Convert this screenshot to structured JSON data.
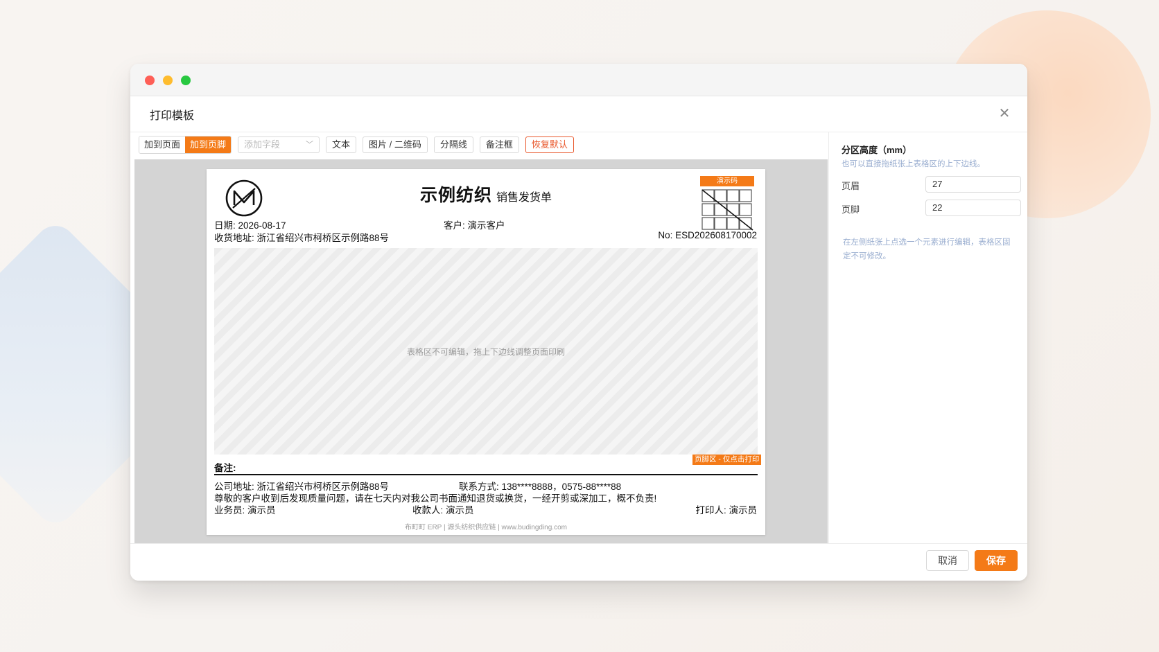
{
  "dialog": {
    "title": "打印模板"
  },
  "toolbar": {
    "add_to_page": "加到页面",
    "add_to_footer": "加到页脚",
    "add_field_placeholder": "添加字段",
    "text": "文本",
    "image_qr": "图片 / 二维码",
    "divider": "分隔线",
    "note_box": "备注框",
    "restore_default": "恢复默认"
  },
  "paper": {
    "company_name": "示例纺织",
    "doc_type": "销售发货单",
    "demo_code_label": "演示码",
    "date": "日期: 2026-08-17",
    "customer": "客户: 演示客户",
    "shipping_address": "收货地址: 浙江省绍兴市柯桥区示例路88号",
    "doc_no": "No: ESD202608170002",
    "table_hint": "表格区不可编辑，拖上下边线调整页面印刷",
    "footer_zone_tag": "页脚区 - 仅点击打印",
    "remark_label": "备注:",
    "company_address": "公司地址: 浙江省绍兴市柯桥区示例路88号",
    "contact": "联系方式: 138****8888，0575-88****88",
    "notice": "尊敬的客户收到后发现质量问题，请在七天内对我公司书面通知退货或换货，一经开剪或深加工，概不负责!",
    "salesperson": "业务员: 演示员",
    "payee": "收款人: 演示员",
    "printer": "打印人: 演示员",
    "brand_line": "布町町 ERP | 源头纺织供应链 | www.budingding.com"
  },
  "panel": {
    "section_title": "分区高度（mm）",
    "section_hint": "也可以直接拖纸张上表格区的上下边线。",
    "header_label": "页眉",
    "header_value": "27",
    "footer_label": "页脚",
    "footer_value": "22",
    "note": "在左侧纸张上点选一个元素进行编辑，表格区固定不可修改。"
  },
  "footer": {
    "cancel": "取消",
    "save": "保存"
  },
  "colors": {
    "accent": "#f47a17",
    "danger": "#e9582c",
    "hint": "#9aaed0"
  },
  "icons": [
    "close-icon",
    "chevron-down-icon",
    "logo-icon",
    "qr-placeholder-icon"
  ]
}
